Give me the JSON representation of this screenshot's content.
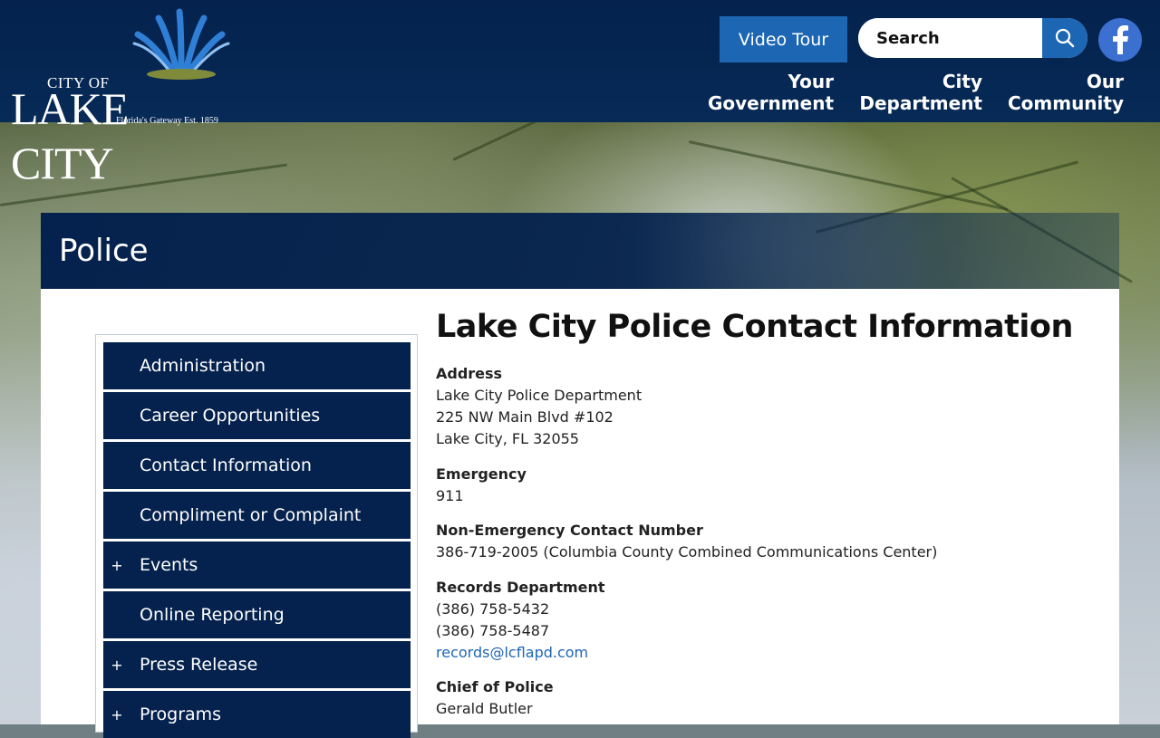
{
  "header": {
    "logo": {
      "city_of": "CITY OF",
      "name": "LAKE CITY",
      "tagline": "Florida's Gateway Est. 1859"
    },
    "video_tour_label": "Video Tour",
    "search": {
      "placeholder": "Search"
    },
    "nav": [
      {
        "line1": "Your",
        "line2": "Government"
      },
      {
        "line1": "City",
        "line2": "Department"
      },
      {
        "line1": "Our",
        "line2": "Community"
      }
    ]
  },
  "page": {
    "title": "Police"
  },
  "sidenav": {
    "items": [
      {
        "label": "Administration",
        "expandable": false
      },
      {
        "label": "Career Opportunities",
        "expandable": false
      },
      {
        "label": "Contact Information",
        "expandable": false
      },
      {
        "label": "Compliment or Complaint",
        "expandable": false
      },
      {
        "label": "Events",
        "expandable": true,
        "expander": "+"
      },
      {
        "label": "Online Reporting",
        "expandable": false
      },
      {
        "label": "Press Release",
        "expandable": true,
        "expander": "+"
      },
      {
        "label": "Programs",
        "expandable": true,
        "expander": "+"
      }
    ]
  },
  "main": {
    "heading": "Lake City Police Contact Information",
    "address": {
      "label": "Address",
      "lines": [
        "Lake City Police Department",
        "225 NW Main Blvd #102",
        "Lake City, FL 32055"
      ]
    },
    "emergency": {
      "label": "Emergency",
      "value": "911"
    },
    "non_emergency": {
      "label": "Non-Emergency Contact Number",
      "value": "386-719-2005 (Columbia County Combined Communications Center)"
    },
    "records": {
      "label": "Records Department",
      "phones": [
        "(386) 758-5432",
        "(386) 758-5487"
      ],
      "email": "records@lcflapd.com"
    },
    "chief": {
      "label": "Chief of Police",
      "name": "Gerald Butler"
    }
  },
  "colors": {
    "navy": "#04224d",
    "accent_blue": "#1d66b3",
    "link": "#1d66b3",
    "facebook": "#3b6fd0"
  },
  "icons": {
    "search": "search-icon",
    "facebook": "facebook-icon",
    "expand": "plus-icon"
  }
}
